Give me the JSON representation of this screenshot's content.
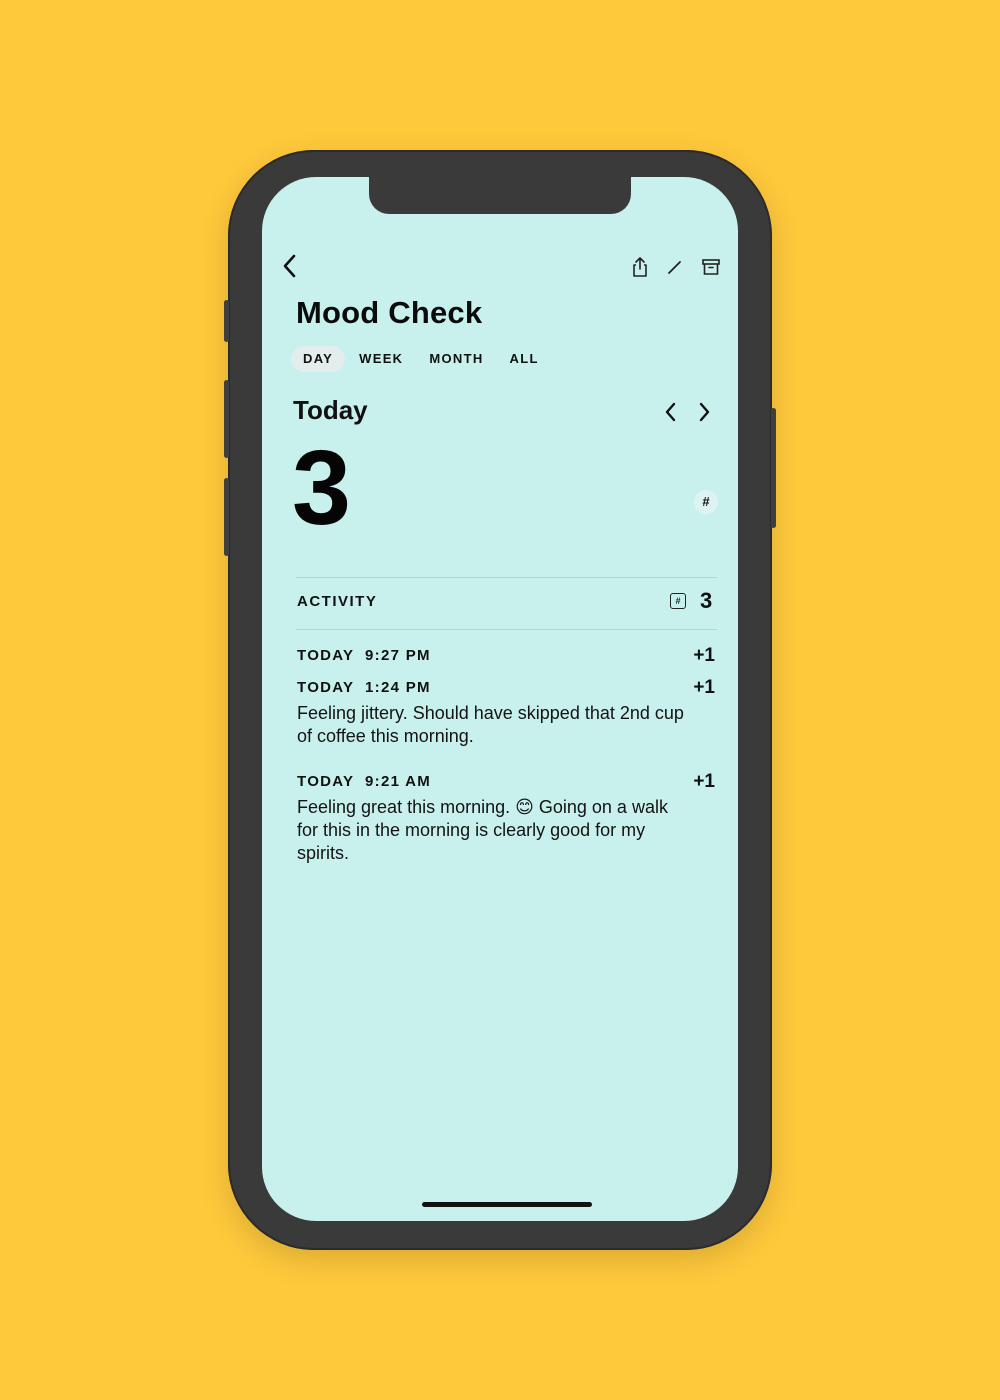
{
  "colors": {
    "background": "#FFC93C",
    "screen": "#C8F0EC",
    "phone_frame": "#3a3a3a",
    "text": "#111111"
  },
  "nav": {
    "back_icon": "chevron-left-icon",
    "actions": [
      "share-icon",
      "pencil-icon",
      "archive-icon"
    ]
  },
  "page": {
    "title": "Mood Check"
  },
  "tabs": [
    {
      "label": "DAY",
      "active": true
    },
    {
      "label": "WEEK",
      "active": false
    },
    {
      "label": "MONTH",
      "active": false
    },
    {
      "label": "ALL",
      "active": false
    }
  ],
  "period": {
    "label": "Today",
    "prev_icon": "chevron-left-icon",
    "next_icon": "chevron-right-icon"
  },
  "summary": {
    "count": "3",
    "unit_badge": "#"
  },
  "activity": {
    "label": "ACTIVITY",
    "badge": "#",
    "count": "3",
    "entries": [
      {
        "time": "TODAY  9:27 PM",
        "delta": "+1",
        "note": ""
      },
      {
        "time": "TODAY  1:24 PM",
        "delta": "+1",
        "note": "Feeling jittery. Should have skipped that 2nd cup of coffee this morning."
      },
      {
        "time": "TODAY  9:21 AM",
        "delta": "+1",
        "note": "Feeling great this morning. 😊 Going on a walk for this in the morning is clearly good for my spirits."
      }
    ]
  }
}
